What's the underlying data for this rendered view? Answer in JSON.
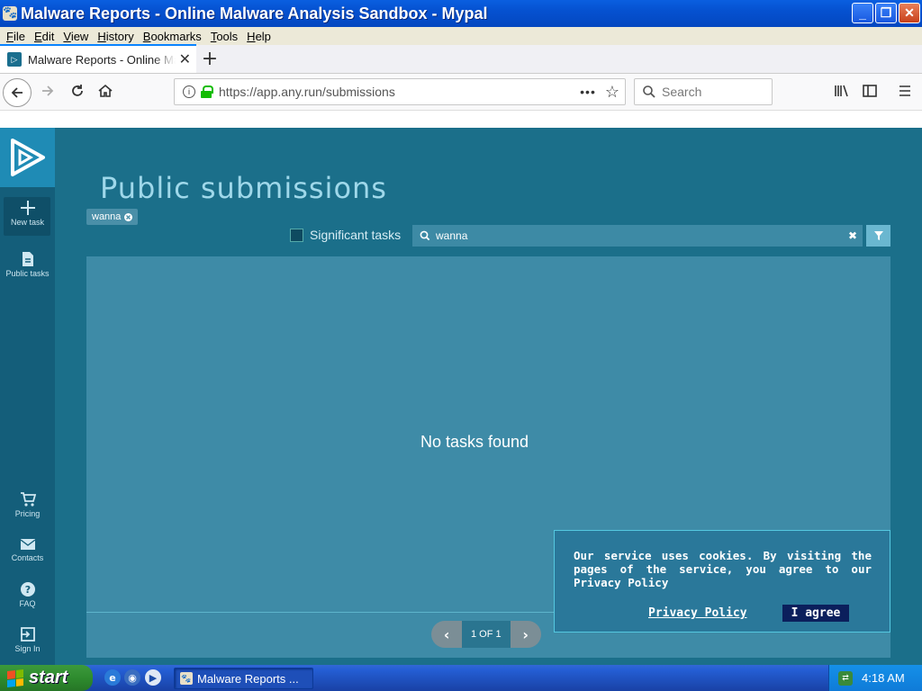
{
  "window": {
    "title": "Malware Reports - Online Malware Analysis Sandbox - Mypal",
    "buttons": {
      "minimize": "_",
      "maximize": "❐",
      "close": "✕"
    }
  },
  "menu": [
    "File",
    "Edit",
    "View",
    "History",
    "Bookmarks",
    "Tools",
    "Help"
  ],
  "tab": {
    "title": "Malware Reports - Online Malware Analysis Sandbox",
    "close": "✕",
    "new_tab": "+"
  },
  "navbar": {
    "url": "https://app.any.run/submissions",
    "search_placeholder": "Search",
    "page_actions": "•••",
    "bookmark_star": "☆"
  },
  "sidebar": {
    "items": [
      {
        "label": "New task",
        "icon": "plus-icon"
      },
      {
        "label": "Public tasks",
        "icon": "document-icon"
      },
      {
        "label": "Pricing",
        "icon": "cart-icon"
      },
      {
        "label": "Contacts",
        "icon": "mail-icon"
      },
      {
        "label": "FAQ",
        "icon": "question-icon"
      },
      {
        "label": "Sign In",
        "icon": "sign-in-icon"
      }
    ]
  },
  "main": {
    "title": "Public submissions",
    "filter_chip": "wanna",
    "significant_label": "Significant tasks",
    "search_value": "wanna",
    "empty_text": "No tasks found",
    "pager": {
      "current": "1 OF 1",
      "prev": "‹",
      "next": "›"
    }
  },
  "cookie": {
    "message": "Our service uses cookies. By visiting the pages of the service, you agree to our Privacy Policy",
    "policy_link": "Privacy Policy",
    "agree_button": "I agree"
  },
  "taskbar": {
    "start": "start",
    "task_item": "Malware Reports ...",
    "clock": "4:18 AM"
  },
  "colors": {
    "accent": "#1b6f8a",
    "sidebar": "#145e7a",
    "results_panel": "#3e8ba7",
    "cookie_button": "#0b1f5c"
  }
}
